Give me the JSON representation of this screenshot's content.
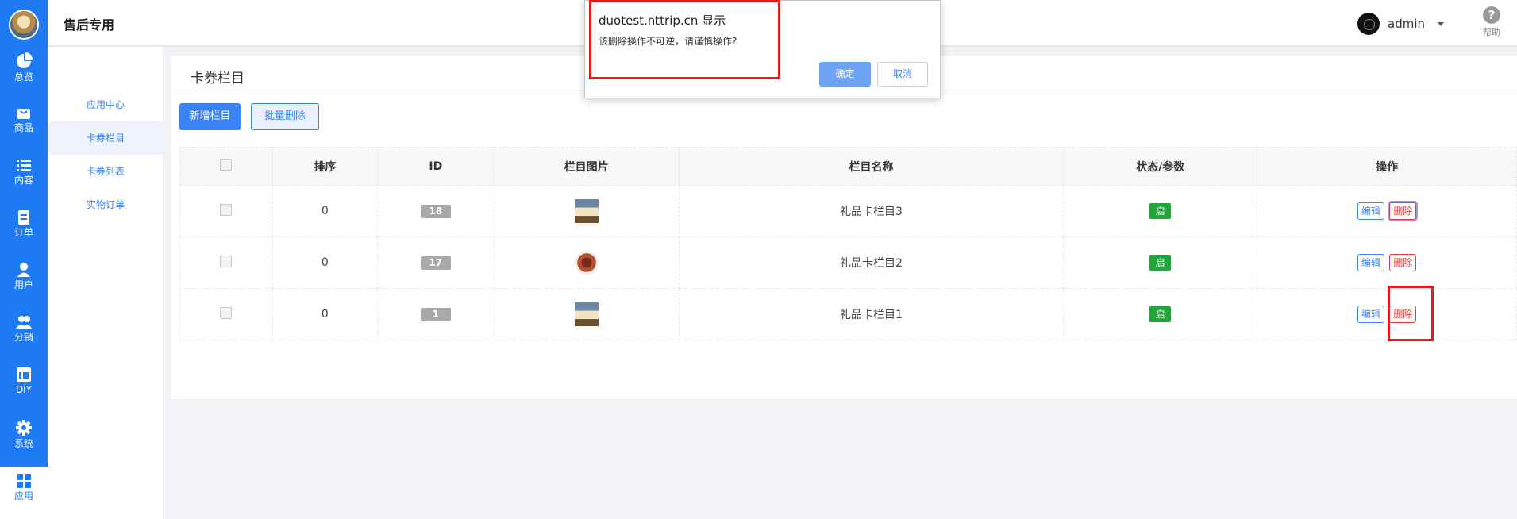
{
  "app": {
    "brand": "售后专用"
  },
  "rail": {
    "items": [
      {
        "label": "总览",
        "icon": "pie-chart-icon"
      },
      {
        "label": "商品",
        "icon": "shopping-bag-icon"
      },
      {
        "label": "内容",
        "icon": "list-icon"
      },
      {
        "label": "订单",
        "icon": "document-icon"
      },
      {
        "label": "用户",
        "icon": "user-icon"
      },
      {
        "label": "分销",
        "icon": "users-icon"
      },
      {
        "label": "DIY",
        "icon": "layout-icon"
      },
      {
        "label": "系统",
        "icon": "gear-icon"
      },
      {
        "label": "应用",
        "icon": "grid-icon"
      }
    ],
    "active": "应用"
  },
  "header": {
    "user": "admin",
    "help": "帮助"
  },
  "subnav": {
    "items": [
      "应用中心",
      "卡券栏目",
      "卡券列表",
      "实物订单"
    ],
    "active": "卡券栏目"
  },
  "page": {
    "title": "卡券栏目",
    "buttons": {
      "add": "新增栏目",
      "batch_delete": "批量删除"
    }
  },
  "table": {
    "headers": {
      "sort": "排序",
      "id": "ID",
      "image": "栏目图片",
      "name": "栏目名称",
      "status": "状态/参数",
      "actions": "操作"
    },
    "rows": [
      {
        "sort": "0",
        "id": "18",
        "image": "dog-photo",
        "name": "礼品卡栏目3",
        "status": "启",
        "edit": "编辑",
        "delete": "删除"
      },
      {
        "sort": "0",
        "id": "17",
        "image": "food-photo",
        "name": "礼品卡栏目2",
        "status": "启",
        "edit": "编辑",
        "delete": "删除"
      },
      {
        "sort": "0",
        "id": "1",
        "image": "dog-photo",
        "name": "礼品卡栏目1",
        "status": "启",
        "edit": "编辑",
        "delete": "删除"
      }
    ]
  },
  "dialog": {
    "title": "duotest.nttrip.cn 显示",
    "message": "该删除操作不可逆，请谨慎操作?",
    "ok": "确定",
    "cancel": "取消"
  },
  "colors": {
    "primary": "#3a84f5",
    "danger": "#e83a3a",
    "success": "#22a53a",
    "annotation": "#e21c1c"
  }
}
